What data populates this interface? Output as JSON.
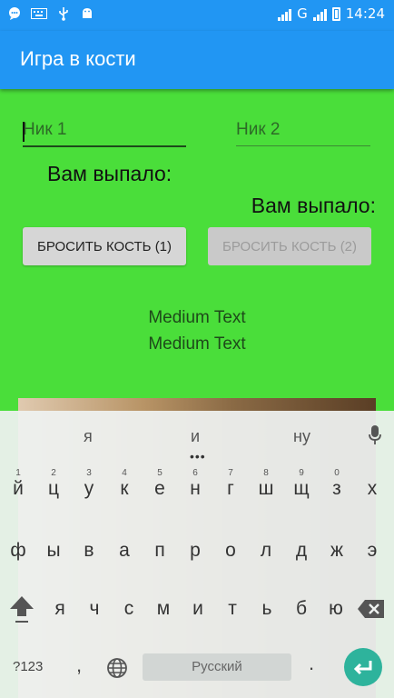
{
  "status": {
    "network": "G",
    "time": "14:24"
  },
  "app": {
    "title": "Игра в кости"
  },
  "form": {
    "nick1_placeholder": "Ник 1",
    "nick2_placeholder": "Ник 2",
    "label1": "Вам выпало:",
    "label2": "Вам выпало:",
    "roll1": "БРОСИТЬ КОСТЬ (1)",
    "roll2": "БРОСИТЬ КОСТЬ (2)",
    "medium1": "Medium Text",
    "medium2": "Medium Text"
  },
  "keyboard": {
    "suggestions": [
      "я",
      "и",
      "ну"
    ],
    "row1": [
      {
        "key": "й",
        "hint": "1"
      },
      {
        "key": "ц",
        "hint": "2"
      },
      {
        "key": "у",
        "hint": "3"
      },
      {
        "key": "к",
        "hint": "4"
      },
      {
        "key": "е",
        "hint": "5"
      },
      {
        "key": "н",
        "hint": "6"
      },
      {
        "key": "г",
        "hint": "7"
      },
      {
        "key": "ш",
        "hint": "8"
      },
      {
        "key": "щ",
        "hint": "9"
      },
      {
        "key": "з",
        "hint": "0"
      },
      {
        "key": "х",
        "hint": ""
      }
    ],
    "row2": [
      "ф",
      "ы",
      "в",
      "а",
      "п",
      "р",
      "о",
      "л",
      "д",
      "ж",
      "э"
    ],
    "row3": [
      "я",
      "ч",
      "с",
      "м",
      "и",
      "т",
      "ь",
      "б",
      "ю"
    ],
    "symbols": "?123",
    "comma": ",",
    "space": "Русский",
    "period": "."
  },
  "colors": {
    "accent": "#2196f3",
    "background": "#4ade3a",
    "enter": "#2eb39c"
  }
}
